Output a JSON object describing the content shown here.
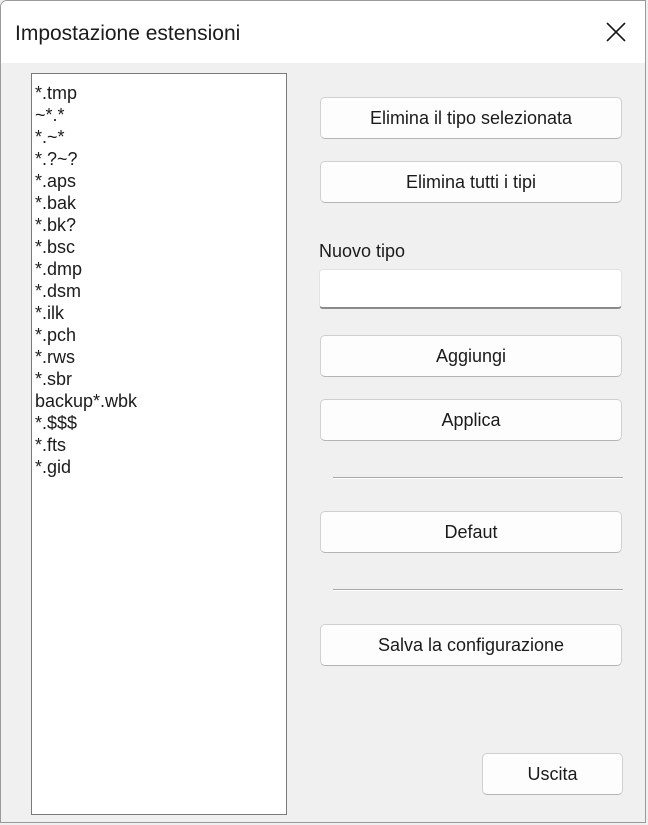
{
  "window": {
    "title": "Impostazione estensioni"
  },
  "extensions": {
    "items": [
      "*.tmp",
      "~*.*",
      "*.~*",
      "*.?~?",
      "*.aps",
      "*.bak",
      "*.bk?",
      "*.bsc",
      "*.dmp",
      "*.dsm",
      "*.ilk",
      "*.pch",
      "*.rws",
      "*.sbr",
      "backup*.wbk",
      "*.$$$",
      "*.fts",
      "*.gid"
    ]
  },
  "buttons": {
    "delete_selected": "Elimina il tipo selezionata",
    "delete_all": "Elimina tutti i tipi",
    "add": "Aggiungi",
    "apply": "Applica",
    "default": "Defaut",
    "save_config": "Salva la configurazione",
    "exit": "Uscita"
  },
  "new_type": {
    "label": "Nuovo tipo",
    "value": ""
  },
  "icons": {
    "close": "close-icon"
  }
}
